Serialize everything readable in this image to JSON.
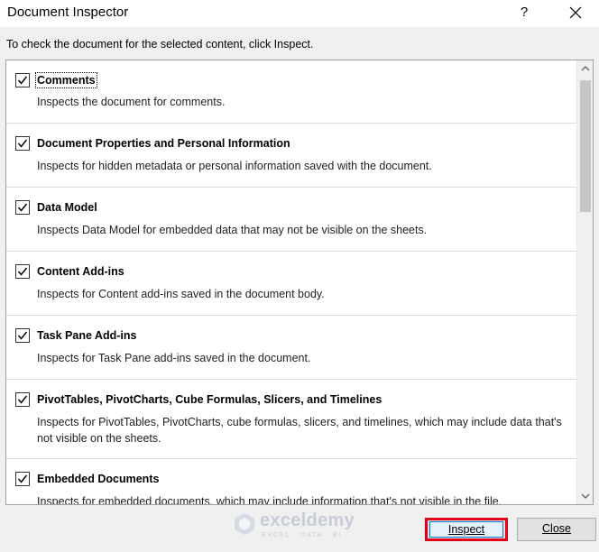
{
  "window": {
    "title": "Document Inspector",
    "help_label": "?"
  },
  "instruction": "To check the document for the selected content, click Inspect.",
  "items": [
    {
      "label": "Comments",
      "desc": "Inspects the document for comments.",
      "checked": true
    },
    {
      "label": "Document Properties and Personal Information",
      "desc": "Inspects for hidden metadata or personal information saved with the document.",
      "checked": true
    },
    {
      "label": "Data Model",
      "desc": "Inspects Data Model for embedded data that may not be visible on the sheets.",
      "checked": true
    },
    {
      "label": "Content Add-ins",
      "desc": "Inspects for Content add-ins saved in the document body.",
      "checked": true
    },
    {
      "label": "Task Pane Add-ins",
      "desc": "Inspects for Task Pane add-ins saved in the document.",
      "checked": true
    },
    {
      "label": "PivotTables, PivotCharts, Cube Formulas, Slicers, and Timelines",
      "desc": "Inspects for PivotTables, PivotCharts, cube formulas, slicers, and timelines, which may include data that's not visible on the sheets.",
      "checked": true
    },
    {
      "label": "Embedded Documents",
      "desc": "Inspects for embedded documents, which may include information that's not visible in the file.",
      "checked": true
    }
  ],
  "watermark": {
    "brand": "exceldemy",
    "tagline": "EXCEL · DATA · BI"
  },
  "buttons": {
    "inspect_label": "Inspect",
    "close_label": "Close"
  },
  "colors": {
    "highlight_border": "#e2001a",
    "focus_border": "#0078d7"
  }
}
